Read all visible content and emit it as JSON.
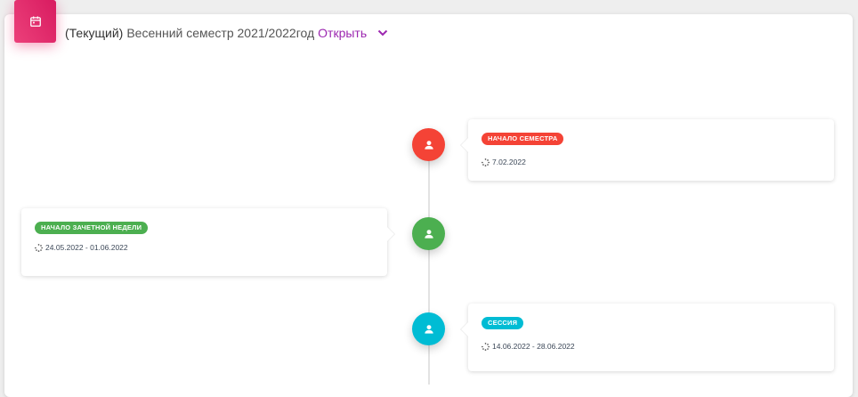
{
  "header": {
    "current_label": "(Текущий)",
    "semester_label": "Весенний семестр 2021/2022год",
    "open_link": "Открыть",
    "icon": "calendar-icon",
    "accent_color": "#e91e63",
    "link_color": "#9c27b0"
  },
  "timeline": {
    "events": [
      {
        "tag": "Начало семестра",
        "date": "7.02.2022",
        "color": "#f44336",
        "icon": "person-icon",
        "side": "right"
      },
      {
        "tag": "Начало зачетной недели",
        "date": "24.05.2022 - 01.06.2022",
        "color": "#4caf50",
        "icon": "person-icon",
        "side": "left"
      },
      {
        "tag": "Сессия",
        "date": "14.06.2022 - 28.06.2022",
        "color": "#00bcd4",
        "icon": "person-icon",
        "side": "right"
      }
    ]
  }
}
